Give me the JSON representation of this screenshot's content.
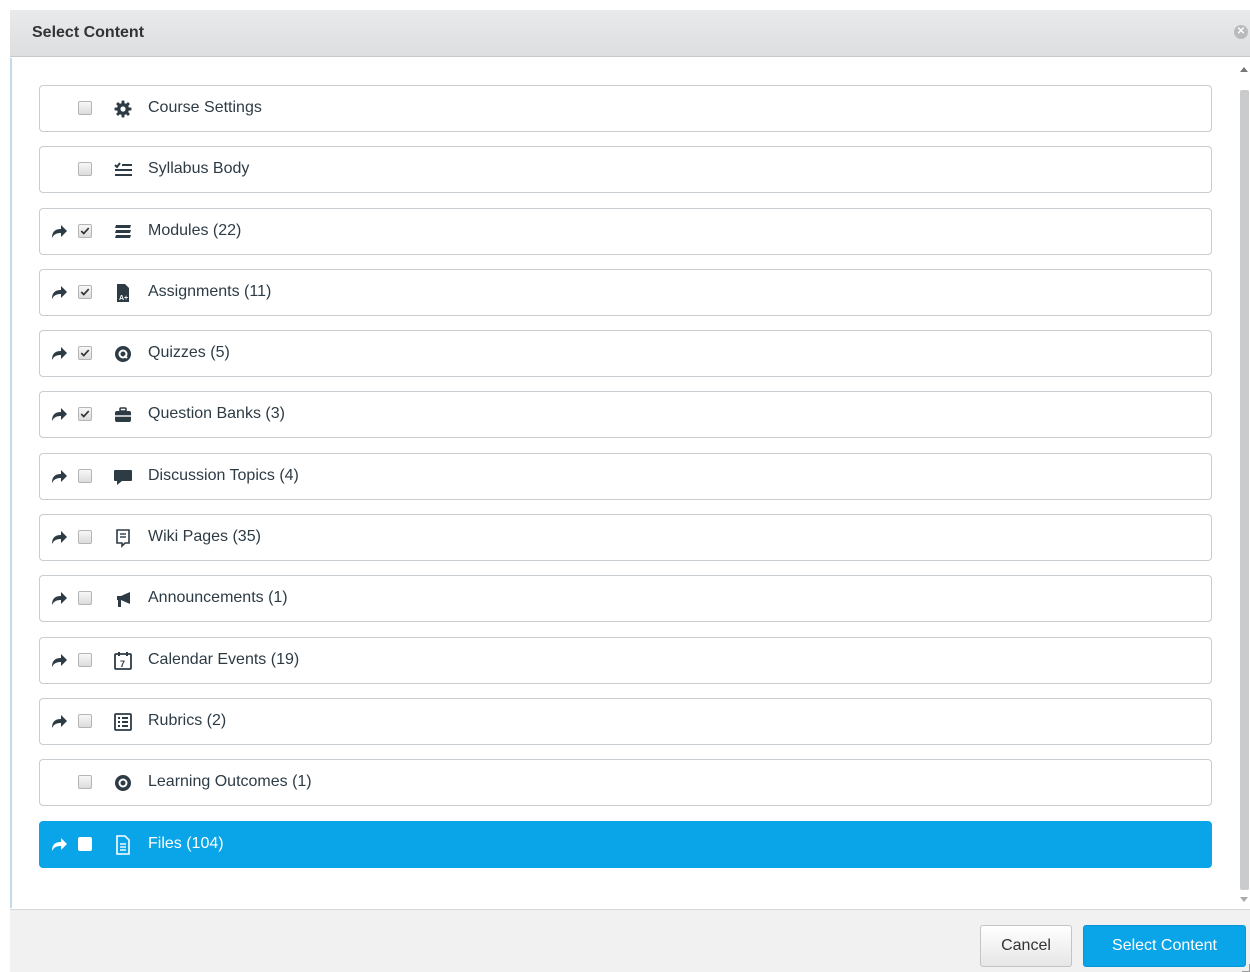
{
  "dialog": {
    "title": "Select Content",
    "close_icon": "close-circle-icon"
  },
  "items": [
    {
      "label": "Course Settings",
      "icon": "gear-icon",
      "expandable": false,
      "checked": false,
      "selected": false
    },
    {
      "label": "Syllabus Body",
      "icon": "checklist-icon",
      "expandable": false,
      "checked": false,
      "selected": false
    },
    {
      "label": "Modules (22)",
      "icon": "modules-stack-icon",
      "expandable": true,
      "checked": true,
      "selected": false
    },
    {
      "label": "Assignments (11)",
      "icon": "assignment-doc-icon",
      "expandable": true,
      "checked": true,
      "selected": false
    },
    {
      "label": "Quizzes (5)",
      "icon": "quiz-icon",
      "expandable": true,
      "checked": true,
      "selected": false
    },
    {
      "label": "Question Banks (3)",
      "icon": "briefcase-icon",
      "expandable": true,
      "checked": true,
      "selected": false
    },
    {
      "label": "Discussion Topics (4)",
      "icon": "speech-bubble-icon",
      "expandable": true,
      "checked": false,
      "selected": false
    },
    {
      "label": "Wiki Pages (35)",
      "icon": "page-icon",
      "expandable": true,
      "checked": false,
      "selected": false
    },
    {
      "label": "Announcements (1)",
      "icon": "megaphone-icon",
      "expandable": true,
      "checked": false,
      "selected": false
    },
    {
      "label": "Calendar Events (19)",
      "icon": "calendar-icon",
      "expandable": true,
      "checked": false,
      "selected": false
    },
    {
      "label": "Rubrics (2)",
      "icon": "rubric-icon",
      "expandable": true,
      "checked": false,
      "selected": false
    },
    {
      "label": "Learning Outcomes (1)",
      "icon": "outcomes-badge-icon",
      "expandable": false,
      "checked": false,
      "selected": false
    },
    {
      "label": "Files (104)",
      "icon": "file-icon",
      "expandable": true,
      "checked": false,
      "selected": true
    }
  ],
  "footer": {
    "cancel_label": "Cancel",
    "select_label": "Select Content"
  },
  "colors": {
    "accent": "#0aa4e8",
    "text": "#2d3b45",
    "row_border": "#c7cdd1"
  }
}
